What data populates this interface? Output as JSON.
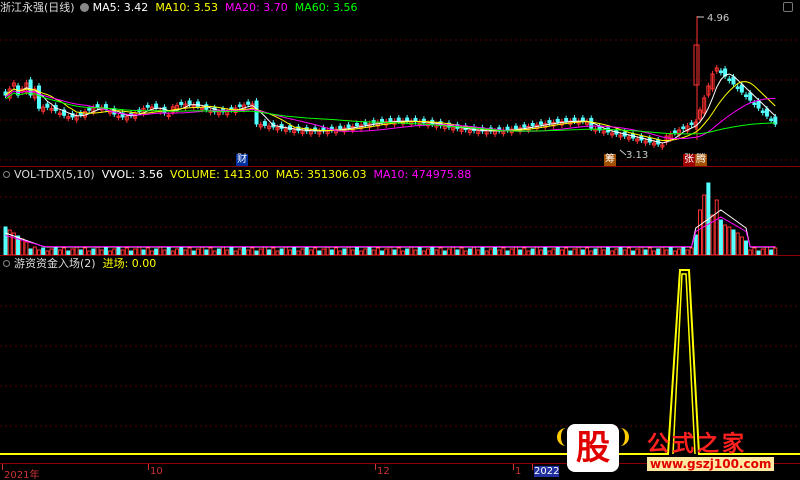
{
  "price_panel": {
    "title": "浙江永强(日线)",
    "ma5": "MA5: 3.42",
    "ma10": "MA10: 3.53",
    "ma20": "MA20: 3.70",
    "ma60": "MA60: 3.56",
    "high_label": "4.96",
    "low_label": "3.13",
    "colors": {
      "ma5": "#ffffff",
      "ma10": "#ffff00",
      "ma20": "#ff00ff",
      "ma60": "#00ff00",
      "up": "#ff3232",
      "down": "#54ffff"
    }
  },
  "events": {
    "cai": "财",
    "chou": "筹",
    "zhang": "张",
    "teng": "腾"
  },
  "volume_panel": {
    "name": "VOL-TDX(5,10)",
    "vvol": "VVOL: 3.56",
    "volume": "VOLUME: 1413.00",
    "ma5": "MA5: 351306.03",
    "ma10": "MA10: 474975.88"
  },
  "indicator_panel": {
    "name": "游资资金入场(2)",
    "entry": "进场: 0.00"
  },
  "time_axis": {
    "labels": [
      "2021年",
      "10",
      "12",
      "1",
      "2022"
    ]
  },
  "watermark": {
    "logo": "股",
    "site": "公式之家",
    "url": "www.gszj100.com"
  }
}
